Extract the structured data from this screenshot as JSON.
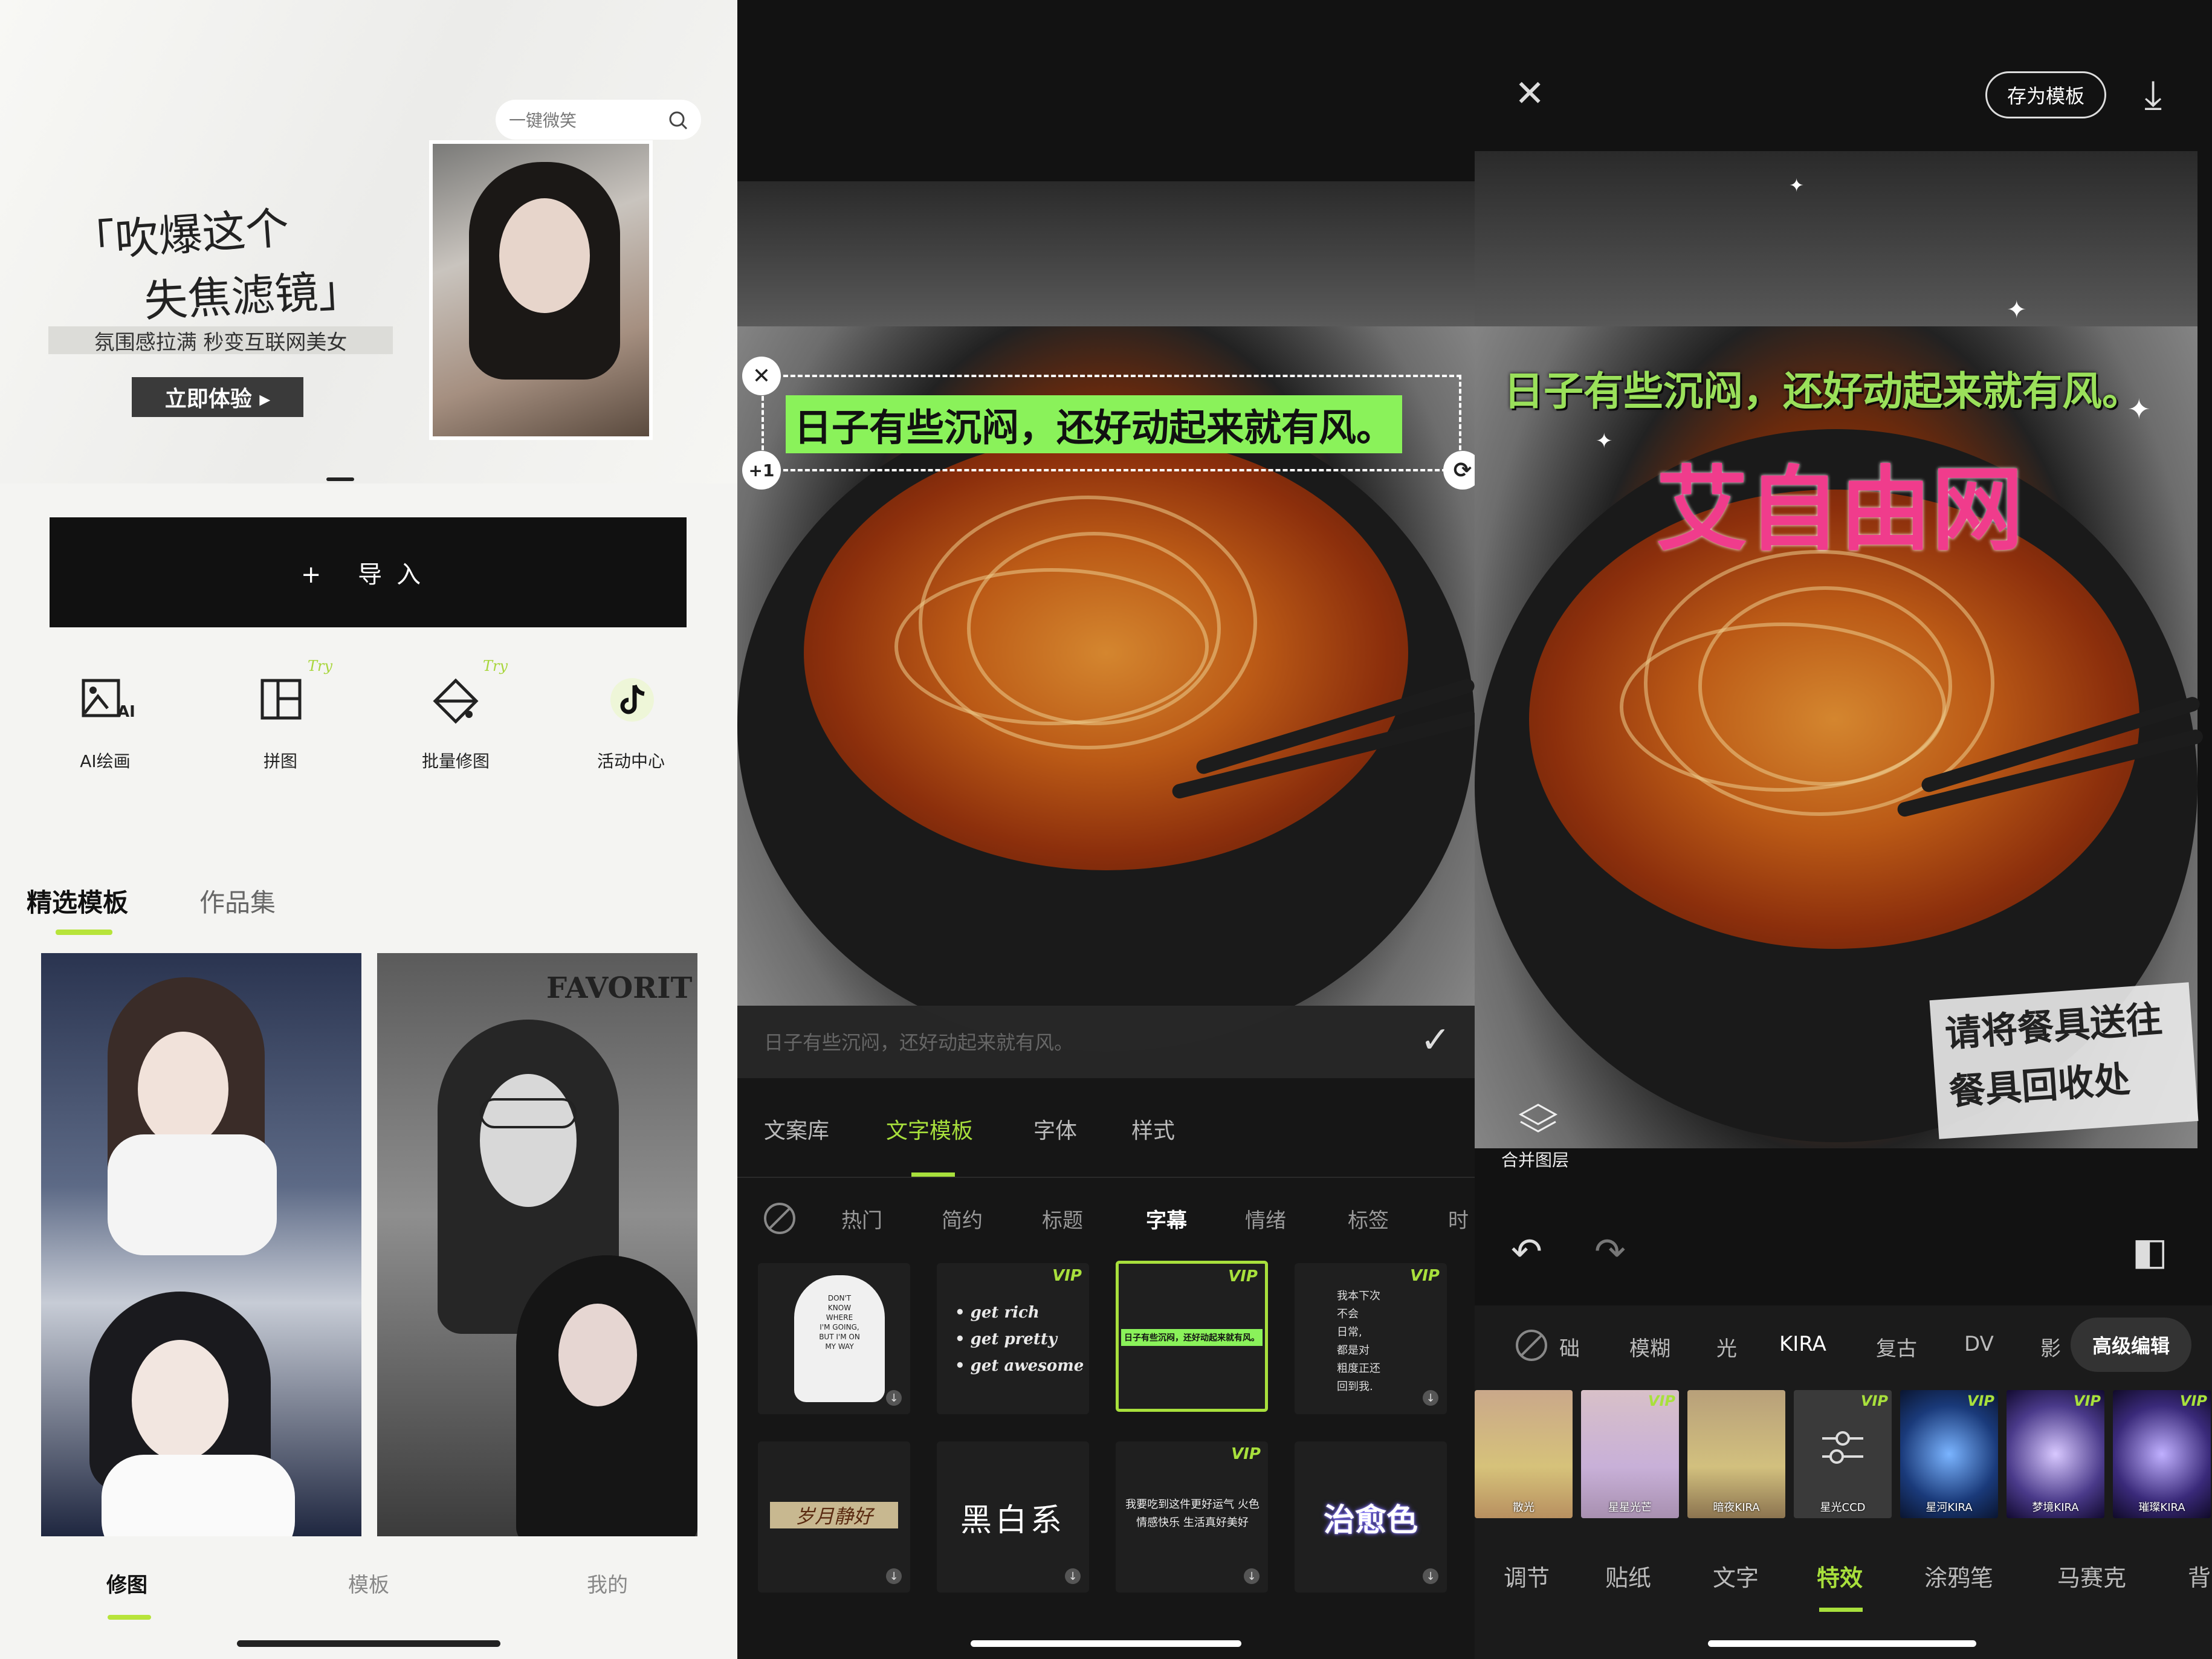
{
  "left_panel": {
    "search_placeholder": "一键微笑",
    "banner": {
      "slogan_line1": "「吹爆这个",
      "slogan_line2": "失焦滤镜」",
      "subtitle": "氛围感拉满 秒变互联网美女",
      "cta": "立即体验 ▸"
    },
    "import_button": "+ 导入",
    "tools": [
      {
        "label": "AI绘画",
        "icon": "ai-image-icon",
        "badge": ""
      },
      {
        "label": "拼图",
        "icon": "collage-icon",
        "badge": "Try"
      },
      {
        "label": "批量修图",
        "icon": "batch-edit-icon",
        "badge": "Try"
      },
      {
        "label": "活动中心",
        "icon": "tiktok-icon",
        "badge": ""
      }
    ],
    "tabs": [
      {
        "label": "精选模板",
        "active": true
      },
      {
        "label": "作品集",
        "active": false
      }
    ],
    "card_overlay_text": "FAVORIT",
    "bottom_nav": [
      {
        "label": "修图",
        "active": true
      },
      {
        "label": "模板",
        "active": false
      },
      {
        "label": "我的",
        "active": false
      }
    ],
    "colors": {
      "accent": "#b7e43a"
    }
  },
  "middle_panel": {
    "caption_text": "日子有些沉闷，还好动起来就有风。",
    "close_glyph": "✕",
    "plus_badge": "+1",
    "rotate_glyph": "⟳",
    "input_placeholder": "日子有些沉闷，还好动起来就有风。",
    "confirm_glyph": "✓",
    "tabs": [
      {
        "label": "文案库",
        "active": false
      },
      {
        "label": "文字模板",
        "active": true
      },
      {
        "label": "字体",
        "active": false
      },
      {
        "label": "样式",
        "active": false
      }
    ],
    "categories": [
      {
        "label": "热门",
        "active": false
      },
      {
        "label": "简约",
        "active": false
      },
      {
        "label": "标题",
        "active": false
      },
      {
        "label": "字幕",
        "active": true
      },
      {
        "label": "情绪",
        "active": false
      },
      {
        "label": "标签",
        "active": false
      },
      {
        "label": "时",
        "active": false
      }
    ],
    "templates_row1": [
      {
        "vip": "",
        "lines": [
          "DON'T",
          "KNOW",
          "WHERE",
          "I'M GOING,",
          "BUT I'M ON",
          "MY WAY"
        ]
      },
      {
        "vip": "VIP",
        "lines": [
          "get rich",
          "get pretty",
          "get awesome"
        ]
      },
      {
        "vip": "VIP",
        "lines": [
          "日子有些沉闷，还好动起来就有风。"
        ]
      },
      {
        "vip": "VIP",
        "lines": [
          "我本下次",
          "不会",
          "日常,",
          "都是对",
          "粗度正还",
          "回到我."
        ]
      }
    ],
    "templates_row2": [
      {
        "vip": "",
        "text": "岁月静好"
      },
      {
        "vip": "",
        "text": "黑白系"
      },
      {
        "vip": "VIP",
        "text": "我要吃到这件更好运气 火色情感快乐 生活真好美好"
      },
      {
        "vip": "",
        "text": "治愈色"
      }
    ],
    "colors": {
      "accent": "#a8e03c",
      "caption_bg": "#8af25a"
    }
  },
  "right_panel": {
    "close_glyph": "✕",
    "save_template": "存为模板",
    "download_glyph": "⤓",
    "caption_text": "日子有些沉闷，还好动起来就有风。",
    "watermark": "艾自由网",
    "sign_lines": [
      "请将餐具送往",
      "餐具回收处"
    ],
    "merge_layers": "合并图层",
    "undo_glyph": "↶",
    "redo_glyph": "↷",
    "compare_glyph": "◧",
    "filter_categories": [
      {
        "label": "础",
        "active": false
      },
      {
        "label": "模糊",
        "active": false
      },
      {
        "label": "光",
        "active": false
      },
      {
        "label": "KIRA",
        "active": false
      },
      {
        "label": "复古",
        "active": false
      },
      {
        "label": "DV",
        "active": false
      },
      {
        "label": "影",
        "active": false
      },
      {
        "label": "高级编辑",
        "active": true
      }
    ],
    "filters": [
      {
        "label": "散光",
        "vip": ""
      },
      {
        "label": "星星光芒",
        "vip": "VIP"
      },
      {
        "label": "暗夜KIRA",
        "vip": ""
      },
      {
        "label": "星光CCD",
        "vip": "VIP"
      },
      {
        "label": "星河KIRA",
        "vip": "VIP"
      },
      {
        "label": "梦境KIRA",
        "vip": "VIP"
      },
      {
        "label": "璀璨KIRA",
        "vip": "VIP"
      }
    ],
    "bottom_nav": [
      {
        "label": "调节",
        "active": false
      },
      {
        "label": "贴纸",
        "active": false
      },
      {
        "label": "文字",
        "active": false
      },
      {
        "label": "特效",
        "active": true
      },
      {
        "label": "涂鸦笔",
        "active": false
      },
      {
        "label": "马赛克",
        "active": false
      },
      {
        "label": "背",
        "active": false
      }
    ],
    "colors": {
      "accent": "#a8e03c",
      "watermark": "#f03c8c"
    }
  }
}
